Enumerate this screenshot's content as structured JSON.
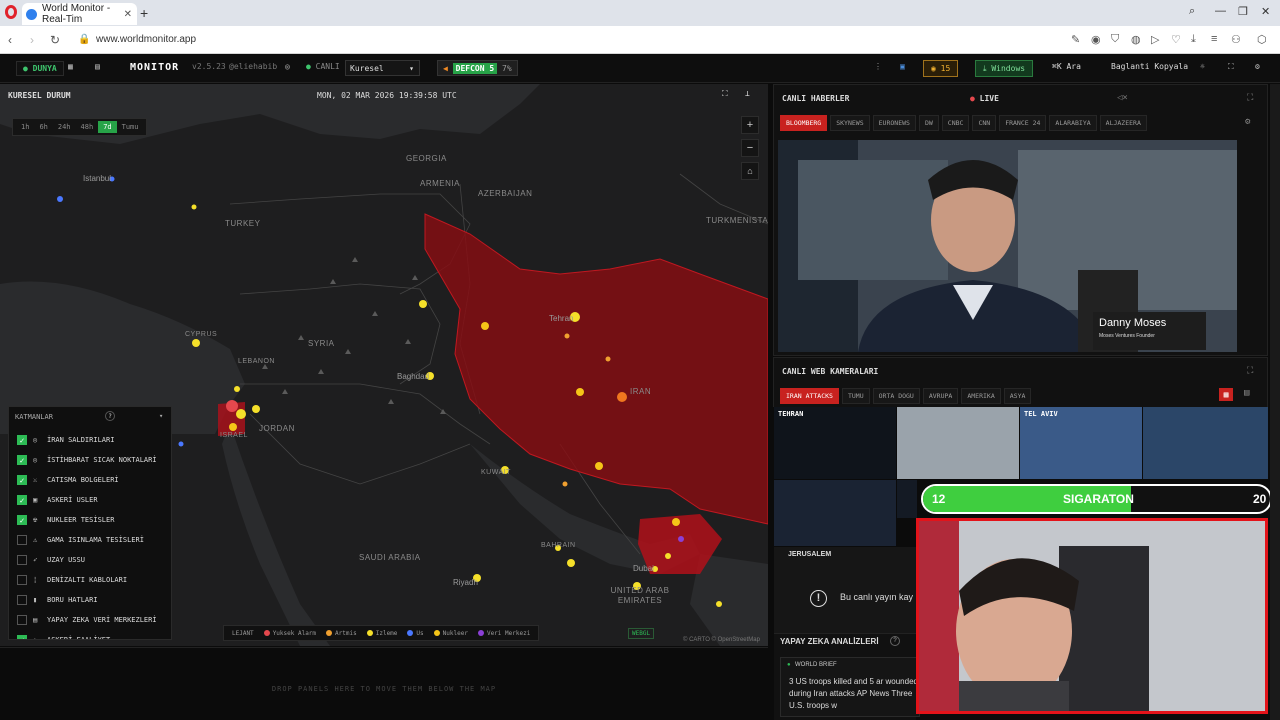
{
  "browser": {
    "tab_title": "World Monitor - Real-Tim",
    "new_tab": "+",
    "url": "www.worldmonitor.app"
  },
  "app": {
    "mode": "DUNYA",
    "name": "MONITOR",
    "version": "v2.5.23",
    "handle": "@eliehabib",
    "live_status": "CANLI",
    "region": "Kuresel",
    "defcon_label": "DEFCON",
    "defcon_level": "5",
    "defcon_pct": "7%",
    "badge_count": "15",
    "windows_button": "Windows",
    "search_label": "Ara",
    "search_shortcut": "⌘K",
    "copy_link": "Baglanti Kopyala"
  },
  "map": {
    "title": "KURESEL DURUM",
    "clock": "MON, 02 MAR 2026 19:39:58 UTC",
    "time_ranges": [
      "1h",
      "6h",
      "24h",
      "48h",
      "7d",
      "Tumu"
    ],
    "active_range": "7d",
    "zoom_in": "+",
    "zoom_out": "−",
    "labels": {
      "istanbul": "Istanbul",
      "georgia": "GEORGIA",
      "armenia": "ARMENIA",
      "azerbaijan": "AZERBAIJAN",
      "turkey": "TURKEY",
      "turkmenistan": "TURKMENISTAN",
      "cyprus": "CYPRUS",
      "syria": "SYRIA",
      "lebanon": "LEBANON",
      "tehran": "Tehran",
      "iran": "IRAN",
      "baghdad": "Baghdad",
      "jordan": "JORDAN",
      "israel": "ISRAEL",
      "kuwait": "KUWAIT",
      "saudi": "SAUDI ARABIA",
      "bahrain": "BAHRAIN",
      "riyadh": "Riyadh",
      "dubai": "Dubai",
      "uae": "UNITED ARAB EMIRATES"
    },
    "layers_title": "KATMANLAR",
    "layers_help": "?",
    "layers": [
      {
        "name": "İRAN SALDIRILARI",
        "checked": true,
        "icon": "target-icon"
      },
      {
        "name": "İSTİHBARAT SICAK NOKTALARİ",
        "checked": true,
        "icon": "target-icon"
      },
      {
        "name": "CATISMA BOLGELERİ",
        "checked": true,
        "icon": "swords-icon"
      },
      {
        "name": "ASKERİ USLER",
        "checked": true,
        "icon": "base-icon"
      },
      {
        "name": "NUKLEER TESİSLER",
        "checked": true,
        "icon": "radiation-icon"
      },
      {
        "name": "GAMA ISINLAMA TESİSLERİ",
        "checked": false,
        "icon": "warning-icon"
      },
      {
        "name": "UZAY USSU",
        "checked": false,
        "icon": "rocket-icon"
      },
      {
        "name": "DENİZALTI KABLOLARI",
        "checked": false,
        "icon": "cable-icon"
      },
      {
        "name": "BORU HATLARI",
        "checked": false,
        "icon": "pipe-icon"
      },
      {
        "name": "YAPAY ZEKA VERİ MERKEZLERİ",
        "checked": false,
        "icon": "server-icon"
      },
      {
        "name": "ASKERİ FAALİYET",
        "checked": true,
        "icon": "plane-icon"
      }
    ],
    "legend_title": "LEJANT",
    "legend": [
      {
        "label": "Yuksek Alarm",
        "color": "#e5484d"
      },
      {
        "label": "Artmis",
        "color": "#f0a030"
      },
      {
        "label": "Izleme",
        "color": "#f5e02a"
      },
      {
        "label": "Us",
        "color": "#4a78ff"
      },
      {
        "label": "Nukleer",
        "color": "#f5c518"
      },
      {
        "label": "Veri Merkezi",
        "color": "#8b3fd6"
      }
    ],
    "webgl": "WEBGL",
    "attribution": "© CARTO © OpenStreetMap",
    "drop_hint": "DROP PANELS HERE TO MOVE THEM BELOW THE MAP"
  },
  "live_news": {
    "title": "CANLI HABERLER",
    "live": "LIVE",
    "channels": [
      "BLOOMBERG",
      "SKYNEWS",
      "EURONEWS",
      "DW",
      "CNBC",
      "CNN",
      "FRANCE 24",
      "ALARABIYA",
      "ALJAZEERA"
    ],
    "active_channel": "BLOOMBERG",
    "speaker_name": "Danny Moses",
    "speaker_role": "Moses Ventures Founder"
  },
  "webcams": {
    "title": "CANLI WEB KAMERALARI",
    "tabs": [
      "IRAN ATTACKS",
      "TUMU",
      "ORTA DOGU",
      "AVRUPA",
      "AMERIKA",
      "ASYA"
    ],
    "active_tab": "IRAN ATTACKS",
    "cams": [
      "TEHRAN",
      "TEL AVIV",
      "JERUSALEM"
    ],
    "offline_msg": "Bu canlı yayın kay"
  },
  "overlay": {
    "left_value": "12",
    "label": "SIGARATON",
    "right_value": "20",
    "progress": 0.6
  },
  "ai": {
    "title": "YAPAY ZEKA ANALİZLERİ",
    "help": "?",
    "brief_label": "WORLD BRIEF",
    "brief_text": "3 US troops killed and 5 ar wounded during Iran attacks AP News Three U.S. troops w"
  }
}
